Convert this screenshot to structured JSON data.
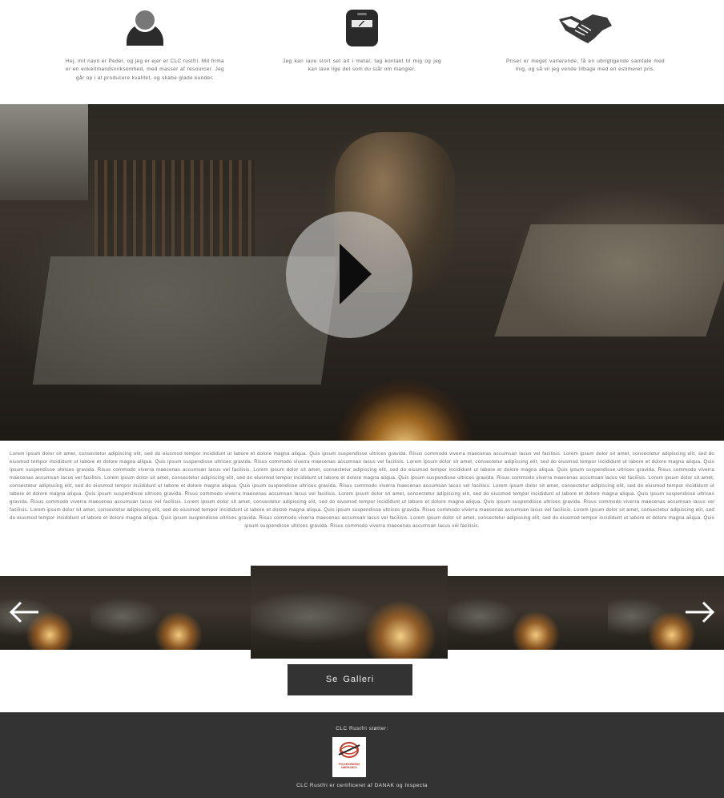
{
  "features": [
    {
      "icon": "person-icon",
      "text": "Hej, mit navn er Peder, og jeg er ejer er CLC rustfri. Mit firma er en enkeltmandsvirksomhed, med masser af resourcer. Jeg går op i at producere kvalitet, og skabe glade kunder."
    },
    {
      "icon": "welding-mask-icon",
      "text": "Jeg kan lave stort set alt i metal, tag kontakt til mig og jeg kan lave lige det som du står om mangler."
    },
    {
      "icon": "handshake-icon",
      "text": "Priser er meget varierende, få en ubrigtigende samtale med mig, og så vil jeg vende tilbage med en estimeret pris."
    }
  ],
  "hero": {
    "play_icon": "play-icon"
  },
  "body_text": "Lorem ipsum dolor sit amet, consectetur adipiscing elit, sed do eiusmod tempor incididunt ut labore et dolore magna aliqua. Quis ipsum suspendisse ultrices gravida. Risus commodo viverra maecenas accumsan lacus vel facilisis. Lorem ipsum dolor sit amet, consectetur adipiscing elit, sed do eiusmod tempor incididunt ut labore et dolore magna aliqua. Quis ipsum suspendisse ultrices gravida. Risus commodo viverra maecenas accumsan lacus vel facilisis. Lorem ipsum dolor sit amet, consectetur adipiscing elit, sed do eiusmod tempor incididunt ut labore et dolore magna aliqua. Quis ipsum suspendisse ultrices gravida. Risus commodo viverra maecenas accumsan lacus vel facilisis. Lorem ipsum dolor sit amet, consectetur adipiscing elit, sed do eiusmod tempor incididunt ut labore et dolore magna aliqua. Quis ipsum suspendisse ultrices gravida. Risus commodo viverra maecenas accumsan lacus vel facilisis. Lorem ipsum dolor sit amet, consectetur adipiscing elit, sed do eiusmod tempor incididunt ut labore et dolore magna aliqua. Quis ipsum suspendisse ultrices gravida. Risus commodo viverra maecenas accumsan lacus vel facilisis. Lorem ipsum dolor sit amet, consectetur adipiscing elit, sed do eiusmod tempor incididunt ut labore et dolore magna aliqua. Quis ipsum suspendisse ultrices gravida. Risus commodo viverra maecenas accumsan lacus vel facilisis. Lorem ipsum dolor sit amet, consectetur adipiscing elit, sed do eiusmod tempor incididunt ut labore et dolore magna aliqua. Quis ipsum suspendisse ultrices gravida. Risus commodo viverra maecenas accumsan lacus vel facilisis. Lorem ipsum dolor sit amet, consectetur adipiscing elit, sed do eiusmod tempor incididunt ut labore et dolore magna aliqua. Quis ipsum suspendisse ultrices gravida. Risus commodo viverra maecenas accumsan lacus vel facilisis. Lorem ipsum dolor sit amet, consectetur adipiscing elit, sed do eiusmod tempor incididunt ut labore et dolore magna aliqua. Quis ipsum suspendisse ultrices gravida. Risus commodo viverra maecenas accumsan lacus vel facilisis. Lorem ipsum dolor sit amet, consectetur adipiscing elit, sed do eiusmod tempor incididunt ut labore et dolore magna aliqua. Quis ipsum suspendisse ultrices gravida. Risus commodo viverra maecenas accumsan lacus vel facilisis. Lorem ipsum dolor sit amet, consectetur adipiscing elit, sed do eiusmod tempor incididunt ut labore et dolore magna aliqua. Quis ipsum suspendisse ultrices gravida. Risus commodo viverra maecenas accumsan lacus vel facilisis. Lorem ipsum dolor sit amet, consectetur adipiscing elit, sed do eiusmod tempor incididunt ut labore et dolore magna aliqua. Quis ipsum suspendisse ultrices gravida. Risus commodo viverra maecenas accumsan lacus vel facilisis.",
  "gallery": {
    "prev_icon": "arrow-left-icon",
    "next_icon": "arrow-right-icon",
    "button_label": "Se  Galleri"
  },
  "footer": {
    "supports_text": "CLC Rustfri støtter:",
    "logo_text": "FOLKEKIRKENS NØDHJÆLP",
    "cert_text": "CLC Rustfri er certificeret af DANAK og Inspecta"
  },
  "colors": {
    "dark": "#333333",
    "logo_red": "#c0392b"
  }
}
